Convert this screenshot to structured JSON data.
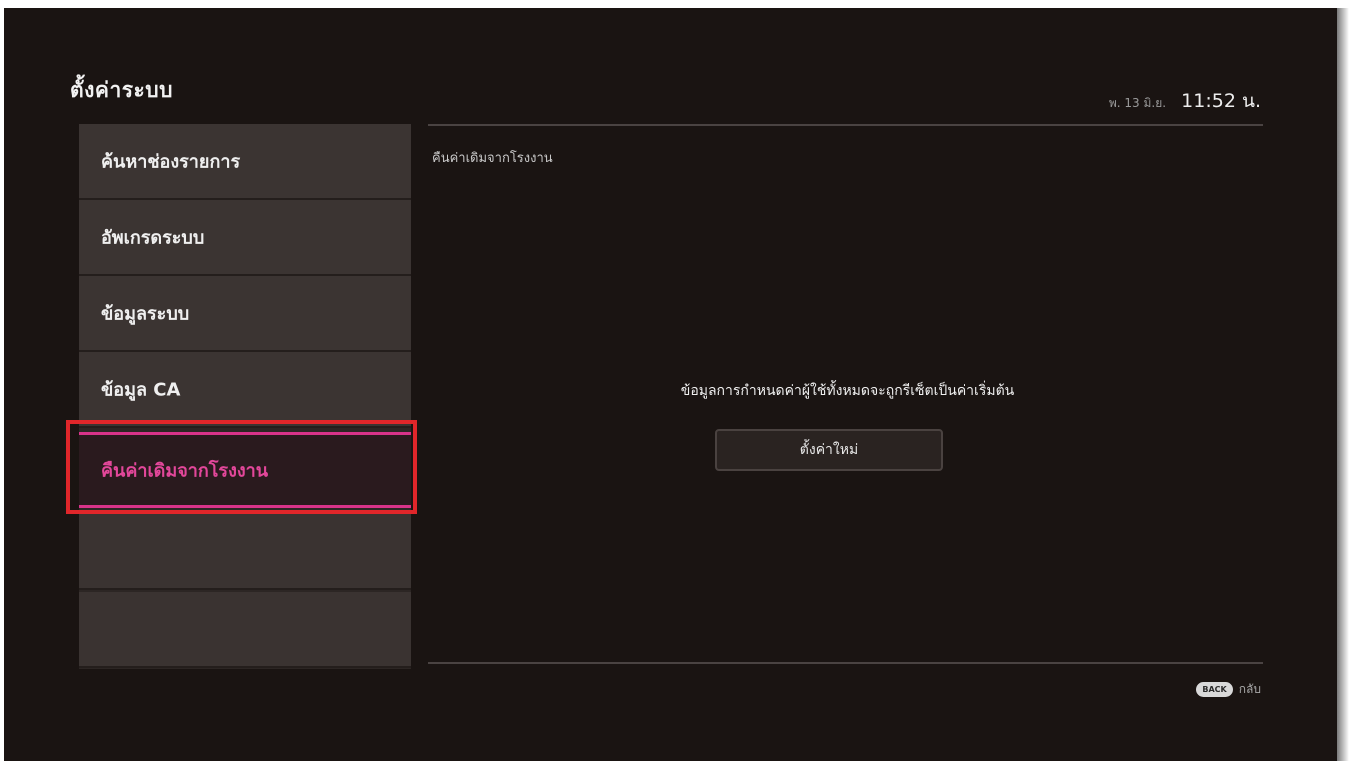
{
  "header": {
    "title": "ตั้งค่าระบบ",
    "date": "พ. 13 มิ.ย.",
    "time": "11:52 น."
  },
  "sidebar": {
    "items": [
      {
        "label": "ค้นหาช่องรายการ",
        "selected": false
      },
      {
        "label": "อัพเกรดระบบ",
        "selected": false
      },
      {
        "label": "ข้อมูลระบบ",
        "selected": false
      },
      {
        "label": "ข้อมูล CA",
        "selected": false
      },
      {
        "label": "คืนค่าเดิมจากโรงงาน",
        "selected": true
      }
    ]
  },
  "content": {
    "section_label": "คืนค่าเดิมจากโรงงาน",
    "message": "ข้อมูลการกำหนดค่าผู้ใช้ทั้งหมดจะถูกรีเซ็ตเป็นค่าเริ่มต้น",
    "reset_button_label": "ตั้งค่าใหม่"
  },
  "footer": {
    "back_key": "BACK",
    "back_label": "กลับ"
  },
  "colors": {
    "background": "#1a1412",
    "selected_accent": "#d8338a",
    "highlight_border": "#e0262a"
  }
}
